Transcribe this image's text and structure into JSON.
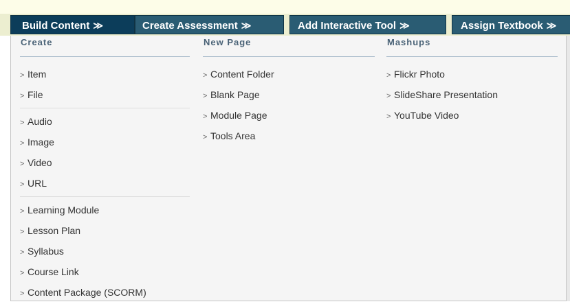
{
  "toolbar": {
    "buttons": [
      {
        "label": "Build Content",
        "chevron": "≫"
      },
      {
        "label": "Create Assessment",
        "chevron": "≫"
      },
      {
        "label": "Add Interactive Tool",
        "chevron": "≫"
      },
      {
        "label": "Assign Textbook",
        "chevron": "≫"
      }
    ]
  },
  "menu": {
    "arrow": ">",
    "create": {
      "heading": "Create",
      "group1": [
        "Item",
        "File"
      ],
      "group2": [
        "Audio",
        "Image",
        "Video",
        "URL"
      ],
      "group3": [
        "Learning Module",
        "Lesson Plan",
        "Syllabus",
        "Course Link",
        "Content Package (SCORM)"
      ]
    },
    "new_page": {
      "heading": "New Page",
      "items": [
        "Content Folder",
        "Blank Page",
        "Module Page",
        "Tools Area"
      ]
    },
    "mashups": {
      "heading": "Mashups",
      "items": [
        "Flickr Photo",
        "SlideShare Presentation",
        "YouTube Video"
      ]
    }
  },
  "colors": {
    "active_button": "#0c3d5a",
    "button": "#2a5c73",
    "heading": "#4a6377",
    "panel_background": "#f5f5f5"
  }
}
